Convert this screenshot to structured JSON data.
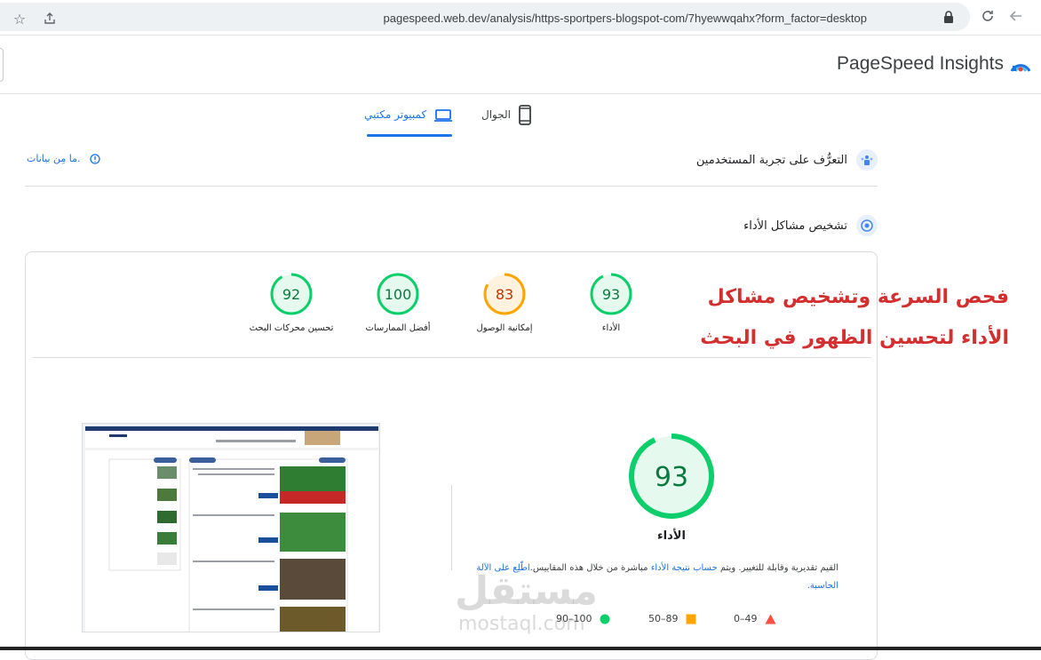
{
  "browser": {
    "url": "pagespeed.web.dev/analysis/https-sportpers-blogspot-com/7hyewwqahx?form_factor=desktop"
  },
  "header": {
    "title": "PageSpeed Insights"
  },
  "tabs": [
    {
      "label": "كمبيوتر مكتبي",
      "active": true
    },
    {
      "label": "الجوال",
      "active": false
    }
  ],
  "sections": {
    "ux": "التعرُّف على تجربة المستخدمين",
    "nodata": "ما مِن بيانات.",
    "diagnose": "تشخيص مشاكل الأداء"
  },
  "scores": [
    {
      "value": 92,
      "label": "تحسين محركات البحث",
      "color": "#0cce6b"
    },
    {
      "value": 100,
      "label": "أفضل الممارسات",
      "color": "#0cce6b"
    },
    {
      "value": 83,
      "label": "إمكانية الوصول",
      "color": "#ffa400"
    },
    {
      "value": 93,
      "label": "الأداء",
      "color": "#0cce6b"
    }
  ],
  "overlay": {
    "line1": "فحص السرعة وتشخيص مشاكل",
    "line2": "الأداء لتحسين الظهور في البحث"
  },
  "performance": {
    "value": 93,
    "title": "الأداء",
    "note_part1": "القيم تقديرية وقابلة للتغيير. ويتم",
    "note_link1": "حساب نتيجة الأداء",
    "note_part2": "مباشرة من خلال هذه المقاييس.",
    "note_link2": "اطّلِع على الآلة الحاسبة."
  },
  "legend": [
    {
      "range": "0–49",
      "color": "#ff4e42",
      "shape": "triangle"
    },
    {
      "range": "50–89",
      "color": "#ffa400",
      "shape": "square"
    },
    {
      "range": "90–100",
      "color": "#0cce6b",
      "shape": "circle"
    }
  ],
  "watermark": {
    "arabic": "مستقل",
    "latin": "mostaql.com"
  }
}
